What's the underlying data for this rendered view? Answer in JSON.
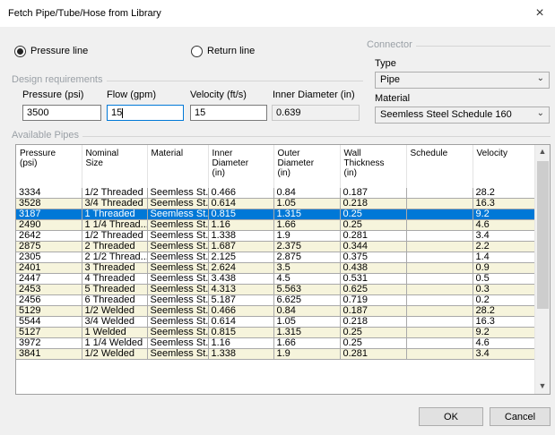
{
  "window": {
    "title": "Fetch Pipe/Tube/Hose from Library",
    "close_glyph": "×"
  },
  "line_type": {
    "pressure_label": "Pressure line",
    "return_label": "Return line",
    "selected": "pressure"
  },
  "design": {
    "group_title": "Design requirements",
    "pressure_label": "Pressure (psi)",
    "pressure_value": "3500",
    "flow_label": "Flow (gpm)",
    "flow_value": "15",
    "velocity_label": "Velocity (ft/s)",
    "velocity_value": "15",
    "inner_diameter_label": "Inner Diameter  (in)",
    "inner_diameter_value": "0.639"
  },
  "connector": {
    "group_title": "Connector",
    "type_label": "Type",
    "type_value": "Pipe",
    "material_label": "Material",
    "material_value": "Seemless Steel Schedule 160"
  },
  "pipes": {
    "group_title": "Available Pipes",
    "headers": [
      "Pressure\n(psi)",
      "Nominal\nSize",
      "Material",
      "Inner\nDiameter\n(in)",
      "Outer\nDiameter\n(in)",
      "Wall\nThickness\n(in)",
      "Schedule",
      "Velocity"
    ],
    "selected_index": 2,
    "rows": [
      [
        "3334",
        "1/2 Threaded",
        "Seemless St...",
        "0.466",
        "0.84",
        "0.187",
        "",
        "28.2"
      ],
      [
        "3528",
        "3/4 Threaded",
        "Seemless St...",
        "0.614",
        "1.05",
        "0.218",
        "",
        "16.3"
      ],
      [
        "3187",
        "1 Threaded",
        "Seemless St...",
        "0.815",
        "1.315",
        "0.25",
        "",
        "9.2"
      ],
      [
        "2490",
        "1 1/4 Thread...",
        "Seemless St...",
        "1.16",
        "1.66",
        "0.25",
        "",
        "4.6"
      ],
      [
        "2642",
        "1/2 Threaded",
        "Seemless St...",
        "1.338",
        "1.9",
        "0.281",
        "",
        "3.4"
      ],
      [
        "2875",
        "2 Threaded",
        "Seemless St...",
        "1.687",
        "2.375",
        "0.344",
        "",
        "2.2"
      ],
      [
        "2305",
        "2 1/2 Thread...",
        "Seemless St...",
        "2.125",
        "2.875",
        "0.375",
        "",
        "1.4"
      ],
      [
        "2401",
        "3 Threaded",
        "Seemless St...",
        "2.624",
        "3.5",
        "0.438",
        "",
        "0.9"
      ],
      [
        "2447",
        "4 Threaded",
        "Seemless St...",
        "3.438",
        "4.5",
        "0.531",
        "",
        "0.5"
      ],
      [
        "2453",
        "5 Threaded",
        "Seemless St...",
        "4.313",
        "5.563",
        "0.625",
        "",
        "0.3"
      ],
      [
        "2456",
        "6 Threaded",
        "Seemless St...",
        "5.187",
        "6.625",
        "0.719",
        "",
        "0.2"
      ],
      [
        "5129",
        "1/2 Welded",
        "Seemless St...",
        "0.466",
        "0.84",
        "0.187",
        "",
        "28.2"
      ],
      [
        "5544",
        "3/4 Welded",
        "Seemless St...",
        "0.614",
        "1.05",
        "0.218",
        "",
        "16.3"
      ],
      [
        "5127",
        "1 Welded",
        "Seemless St...",
        "0.815",
        "1.315",
        "0.25",
        "",
        "9.2"
      ],
      [
        "3972",
        "1 1/4 Welded",
        "Seemless St...",
        "1.16",
        "1.66",
        "0.25",
        "",
        "4.6"
      ],
      [
        "3841",
        "1/2 Welded",
        "Seemless St...",
        "1.338",
        "1.9",
        "0.281",
        "",
        "3.4"
      ]
    ]
  },
  "buttons": {
    "ok": "OK",
    "cancel": "Cancel"
  },
  "colors": {
    "selection": "#0078d7",
    "alt_row": "#f6f4dc",
    "group_title": "#9aa0a6"
  }
}
